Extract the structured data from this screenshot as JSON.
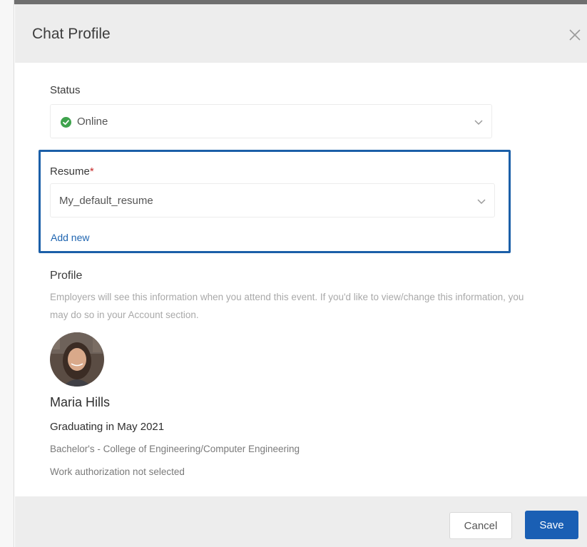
{
  "dialog": {
    "title": "Chat Profile"
  },
  "status": {
    "label": "Status",
    "value": "Online",
    "status_color": "#3fa34d"
  },
  "resume": {
    "label": "Resume",
    "required_mark": "*",
    "value": "My_default_resume",
    "add_new_label": "Add new",
    "highlight_color": "#1b5fa8"
  },
  "profile": {
    "section_title": "Profile",
    "description": "Employers will see this information when you attend this event. If you'd like to view/change this information, you may do so in your Account section.",
    "name": "Maria Hills",
    "graduation": "Graduating in May 2021",
    "degree": "Bachelor's - College of Engineering/Computer Engineering",
    "work_authorization": "Work authorization not selected"
  },
  "footer": {
    "cancel_label": "Cancel",
    "save_label": "Save",
    "accent_color": "#1a5fb4"
  }
}
